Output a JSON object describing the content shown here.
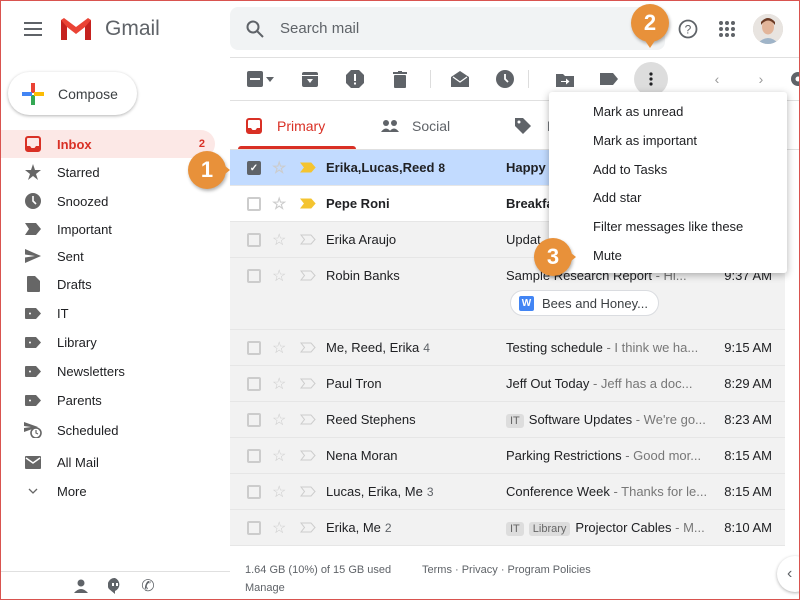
{
  "app": {
    "name": "Gmail",
    "accent": "#d93025"
  },
  "search": {
    "placeholder": "Search mail"
  },
  "compose": {
    "label": "Compose"
  },
  "sidebar": {
    "items": [
      {
        "label": "Inbox",
        "icon": "inbox-icon",
        "count": "2",
        "active": true
      },
      {
        "label": "Starred",
        "icon": "star-icon"
      },
      {
        "label": "Snoozed",
        "icon": "clock-icon"
      },
      {
        "label": "Important",
        "icon": "important-icon"
      },
      {
        "label": "Sent",
        "icon": "send-icon"
      },
      {
        "label": "Drafts",
        "icon": "draft-icon"
      },
      {
        "label": "IT",
        "icon": "label-icon"
      },
      {
        "label": "Library",
        "icon": "label-icon"
      },
      {
        "label": "Newsletters",
        "icon": "label-icon"
      },
      {
        "label": "Parents",
        "icon": "label-icon"
      },
      {
        "label": "Scheduled",
        "icon": "scheduled-icon"
      },
      {
        "label": "All Mail",
        "icon": "mail-icon"
      },
      {
        "label": "More",
        "icon": "chevron-down-icon"
      }
    ]
  },
  "tabs": [
    {
      "label": "Primary",
      "active": true
    },
    {
      "label": "Social"
    },
    {
      "label": "P"
    }
  ],
  "menu": {
    "items": [
      "Mark as unread",
      "Mark as important",
      "Add to Tasks",
      "Add star",
      "Filter messages like these",
      "Mute"
    ]
  },
  "emails": [
    {
      "from": "Erika,Lucas,Reed",
      "count": "8",
      "subject": "Happy H",
      "snippet": "",
      "time": "",
      "state": "selected",
      "important": true
    },
    {
      "from": "Pepe Roni",
      "count": "",
      "subject": "Breakfa",
      "snippet": "",
      "time": "",
      "state": "unread",
      "important": true
    },
    {
      "from": "Erika Araujo",
      "count": "",
      "subject": "Updat",
      "snippet": "",
      "time": "",
      "state": "read"
    },
    {
      "from": "Robin Banks",
      "count": "",
      "subject": "Sample Research Report",
      "snippet": " - Hi...",
      "time": "9:37 AM",
      "state": "read",
      "attachment": "Bees and Honey..."
    },
    {
      "from": "Me, Reed, Erika",
      "count": "4",
      "subject": "Testing schedule",
      "snippet": " - I think we ha...",
      "time": "9:15 AM",
      "state": "read"
    },
    {
      "from": "Paul Tron",
      "count": "",
      "subject": "Jeff Out Today ",
      "snippet": " - Jeff has a doc...",
      "time": "8:29 AM",
      "state": "read"
    },
    {
      "from": "Reed Stephens",
      "count": "",
      "labels": [
        "IT"
      ],
      "subject": "Software Updates",
      "snippet": " - We're go...",
      "time": "8:23 AM",
      "state": "read"
    },
    {
      "from": "Nena Moran",
      "count": "",
      "subject": "Parking Restrictions",
      "snippet": " - Good mor...",
      "time": "8:15 AM",
      "state": "read"
    },
    {
      "from": "Lucas, Erika, Me",
      "count": "3",
      "subject": "Conference Week",
      "snippet": " - Thanks for le...",
      "time": "8:15 AM",
      "state": "read"
    },
    {
      "from": "Erika, Me",
      "count": "2",
      "labels": [
        "IT",
        "Library"
      ],
      "subject": "Projector Cables",
      "snippet": " - M...",
      "time": "8:10 AM",
      "state": "read"
    }
  ],
  "footer": {
    "storage": "1.64 GB (10%) of 15 GB used",
    "manage": "Manage",
    "links": "Terms · Privacy · Program Policies"
  },
  "callouts": [
    "1",
    "2",
    "3"
  ]
}
